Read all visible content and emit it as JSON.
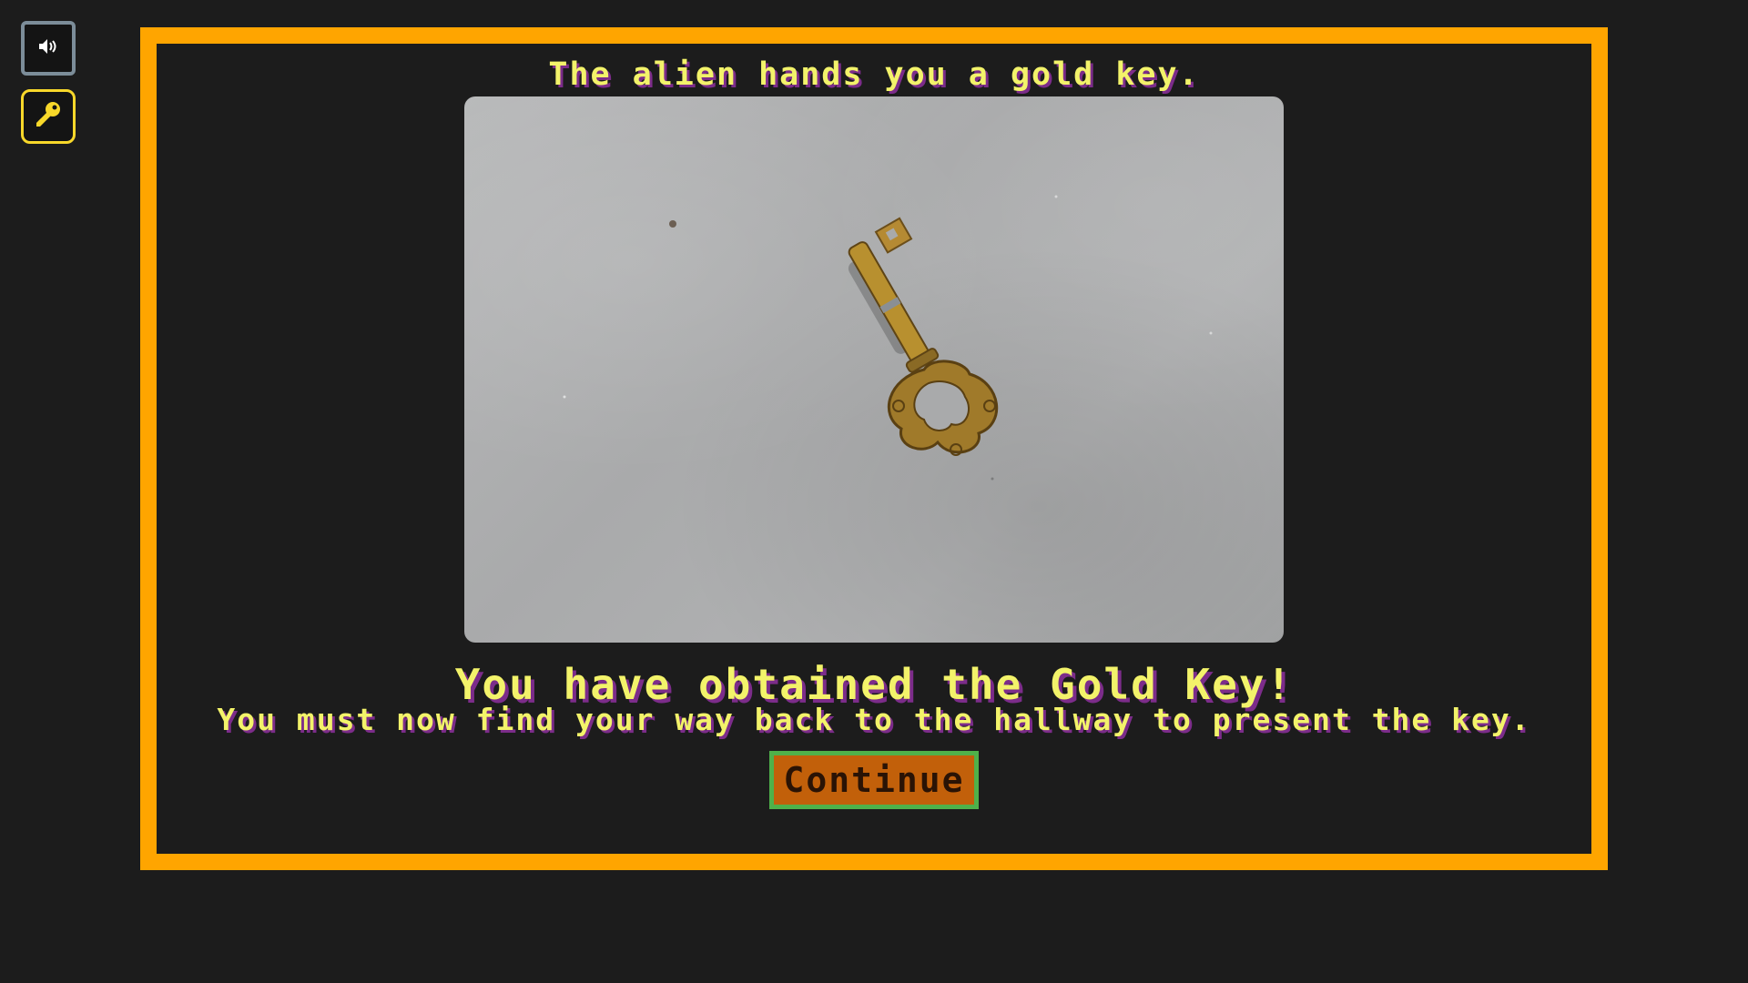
{
  "toolbar": {
    "sound_icon": "speaker-icon",
    "inventory_icon": "key-icon"
  },
  "dialog": {
    "intro": "The alien hands you a gold key.",
    "image_subject": "gold-key",
    "headline": "You have obtained the Gold Key!",
    "message": "You must now find your way back to the hallway to present the key.",
    "continue_label": "Continue"
  },
  "colors": {
    "background": "#1c1c1c",
    "frame": "#ffa500",
    "text": "#f3f36a",
    "text_shadow": "#7c2c8a",
    "button_bg": "#c2600a",
    "button_border": "#4fb14a",
    "key_icon": "#f8d82a"
  }
}
